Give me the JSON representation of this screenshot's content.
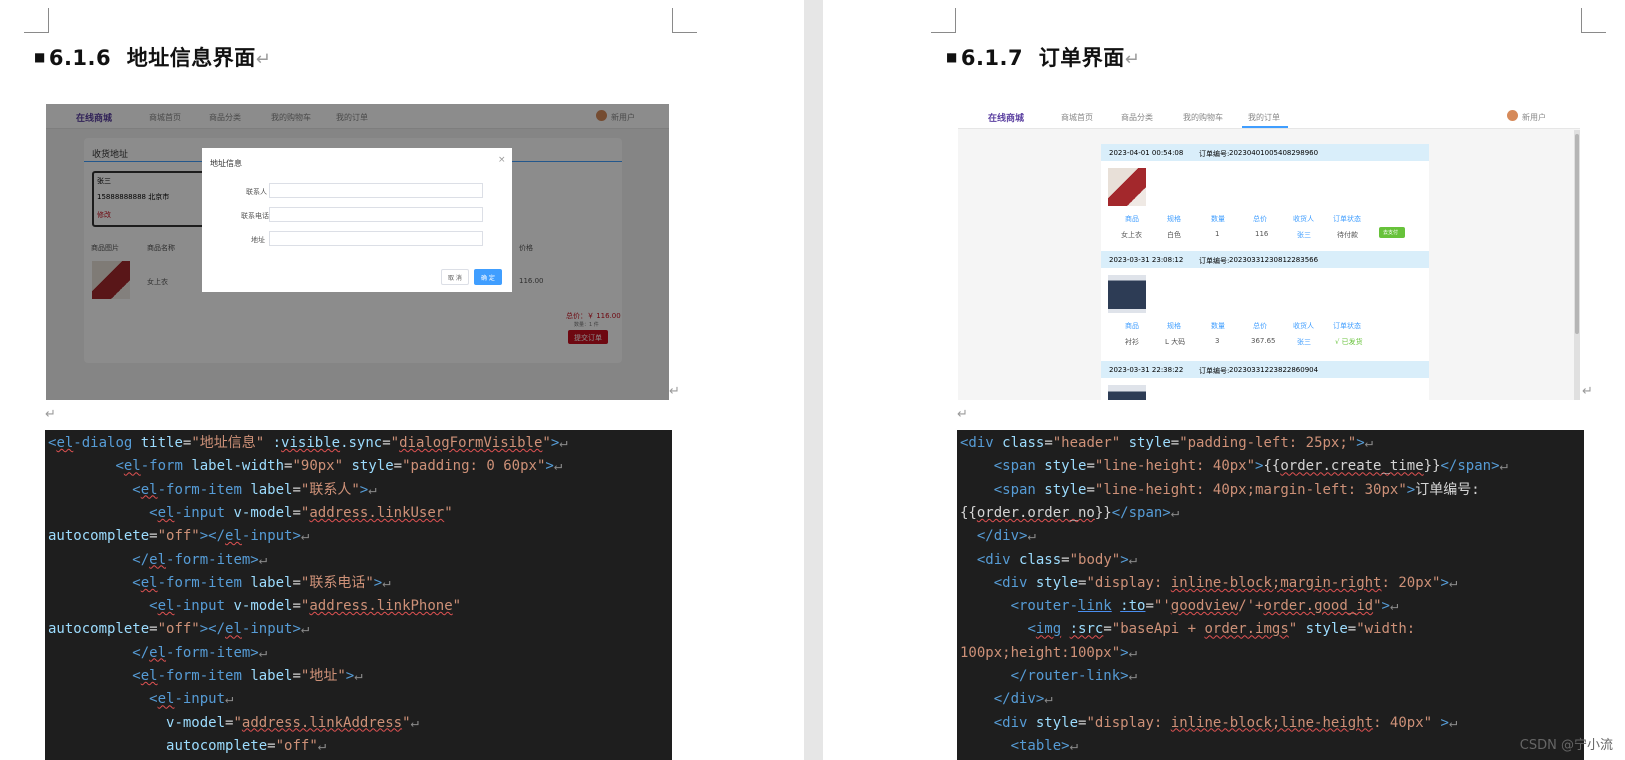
{
  "left": {
    "heading_number": "6.1.6",
    "heading_title": "地址信息界面",
    "screenshot": {
      "nav": {
        "brand": "在线商城",
        "items": [
          "商城首页",
          "商品分类",
          "我的购物车",
          "我的订单"
        ],
        "user": "新用户"
      },
      "address_card_title": "收货地址",
      "address_name": "张三",
      "address_detail": "15888888888 北京市",
      "address_edit": "修改",
      "col_headers": [
        "商品图片",
        "商品名称",
        "价格"
      ],
      "product_name": "女上衣",
      "product_price": "116.00",
      "total": "总价：￥ 116.00",
      "total_sub": "数量：1 件",
      "submit_label": "提交订单",
      "dialog": {
        "title": "地址信息",
        "close": "×",
        "field_labels": [
          "联系人",
          "联系电话",
          "地址"
        ],
        "cancel": "取 消",
        "confirm": "确 定"
      }
    },
    "code_lines": [
      [
        [
          "tg",
          "<"
        ],
        [
          "tg sq",
          "el"
        ],
        [
          "tg",
          "-dialog "
        ],
        [
          "at",
          "title"
        ],
        [
          "tx",
          "="
        ],
        [
          "st",
          "\"地址信息\""
        ],
        [
          "at",
          " :"
        ],
        [
          "at sq",
          "visible"
        ],
        [
          "at",
          ".sync"
        ],
        [
          "tx",
          "="
        ],
        [
          "st",
          "\""
        ],
        [
          "st sq",
          "dialogFormVisible"
        ],
        [
          "st",
          "\""
        ],
        [
          "tg",
          ">"
        ],
        [
          "pm",
          "↵"
        ]
      ],
      [
        [
          "tx",
          "        "
        ],
        [
          "tg",
          "<"
        ],
        [
          "tg sq",
          "el"
        ],
        [
          "tg",
          "-form "
        ],
        [
          "at",
          "label-width"
        ],
        [
          "tx",
          "="
        ],
        [
          "st",
          "\"90px\" "
        ],
        [
          "at",
          "style"
        ],
        [
          "tx",
          "="
        ],
        [
          "st",
          "\"padding: 0 60px\""
        ],
        [
          "tg",
          ">"
        ],
        [
          "pm",
          "↵"
        ]
      ],
      [
        [
          "tx",
          "          "
        ],
        [
          "tg",
          "<"
        ],
        [
          "tg sq",
          "el"
        ],
        [
          "tg",
          "-form-item "
        ],
        [
          "at",
          "label"
        ],
        [
          "tx",
          "="
        ],
        [
          "st",
          "\"联系人\""
        ],
        [
          "tg",
          ">"
        ],
        [
          "pm",
          "↵"
        ]
      ],
      [
        [
          "tx",
          "            "
        ],
        [
          "tg",
          "<"
        ],
        [
          "tg sq",
          "el"
        ],
        [
          "tg",
          "-input "
        ],
        [
          "at",
          "v-model"
        ],
        [
          "tx",
          "="
        ],
        [
          "st",
          "\""
        ],
        [
          "st sq",
          "address.linkUser"
        ],
        [
          "st",
          "\""
        ]
      ],
      [
        [
          "at",
          "autocomplete"
        ],
        [
          "tx",
          "="
        ],
        [
          "st",
          "\"off\""
        ],
        [
          "tg",
          "></"
        ],
        [
          "tg sq",
          "el"
        ],
        [
          "tg",
          "-input>"
        ],
        [
          "pm",
          "↵"
        ]
      ],
      [
        [
          "tx",
          "          "
        ],
        [
          "tg",
          "</"
        ],
        [
          "tg sq",
          "el"
        ],
        [
          "tg",
          "-form-item>"
        ],
        [
          "pm",
          "↵"
        ]
      ],
      [
        [
          "tx",
          "          "
        ],
        [
          "tg",
          "<"
        ],
        [
          "tg sq",
          "el"
        ],
        [
          "tg",
          "-form-item "
        ],
        [
          "at",
          "label"
        ],
        [
          "tx",
          "="
        ],
        [
          "st",
          "\"联系电话\""
        ],
        [
          "tg",
          ">"
        ],
        [
          "pm",
          "↵"
        ]
      ],
      [
        [
          "tx",
          "            "
        ],
        [
          "tg",
          "<"
        ],
        [
          "tg sq",
          "el"
        ],
        [
          "tg",
          "-input "
        ],
        [
          "at",
          "v-model"
        ],
        [
          "tx",
          "="
        ],
        [
          "st",
          "\""
        ],
        [
          "st sq",
          "address.linkPhone"
        ],
        [
          "st",
          "\""
        ]
      ],
      [
        [
          "at",
          "autocomplete"
        ],
        [
          "tx",
          "="
        ],
        [
          "st",
          "\"off\""
        ],
        [
          "tg",
          "></"
        ],
        [
          "tg sq",
          "el"
        ],
        [
          "tg",
          "-input>"
        ],
        [
          "pm",
          "↵"
        ]
      ],
      [
        [
          "tx",
          "          "
        ],
        [
          "tg",
          "</"
        ],
        [
          "tg sq",
          "el"
        ],
        [
          "tg",
          "-form-item>"
        ],
        [
          "pm",
          "↵"
        ]
      ],
      [
        [
          "tx",
          "          "
        ],
        [
          "tg",
          "<"
        ],
        [
          "tg sq",
          "el"
        ],
        [
          "tg",
          "-form-item "
        ],
        [
          "at",
          "label"
        ],
        [
          "tx",
          "="
        ],
        [
          "st",
          "\"地址\""
        ],
        [
          "tg",
          ">"
        ],
        [
          "pm",
          "↵"
        ]
      ],
      [
        [
          "tx",
          "            "
        ],
        [
          "tg",
          "<"
        ],
        [
          "tg sq",
          "el"
        ],
        [
          "tg",
          "-input"
        ],
        [
          "pm",
          "↵"
        ]
      ],
      [
        [
          "tx",
          "              "
        ],
        [
          "at",
          "v-model"
        ],
        [
          "tx",
          "="
        ],
        [
          "st",
          "\""
        ],
        [
          "st sq",
          "address.linkAddress"
        ],
        [
          "st",
          "\""
        ],
        [
          "pm",
          "↵"
        ]
      ],
      [
        [
          "tx",
          "              "
        ],
        [
          "at",
          "autocomplete"
        ],
        [
          "tx",
          "="
        ],
        [
          "st",
          "\"off\""
        ],
        [
          "pm",
          "↵"
        ]
      ]
    ]
  },
  "right": {
    "heading_number": "6.1.7",
    "heading_title": "订单界面",
    "screenshot": {
      "nav": {
        "brand": "在线商城",
        "items": [
          "商城首页",
          "商品分类",
          "我的购物车",
          "我的订单"
        ],
        "user": "新用户"
      },
      "orders": [
        {
          "time": "2023-04-01 00:54:08",
          "no_label": "订单编号:",
          "no": "20230401005408298960",
          "cols": [
            "商品",
            "规格",
            "数量",
            "总价",
            "收货人",
            "订单状态"
          ],
          "vals": [
            "女上衣",
            "白色",
            "1",
            "116",
            "张三",
            "待付款"
          ],
          "action": "去支付"
        },
        {
          "time": "2023-03-31 23:08:12",
          "no_label": "订单编号:",
          "no": "20230331230812283566",
          "cols": [
            "商品",
            "规格",
            "数量",
            "总价",
            "收货人",
            "订单状态"
          ],
          "vals": [
            "衬衫",
            "L 大码",
            "3",
            "367.65",
            "张三",
            "√ 已发货"
          ],
          "action": ""
        },
        {
          "time": "2023-03-31 22:38:22",
          "no_label": "订单编号:",
          "no": "20230331223822860904"
        }
      ]
    },
    "code_lines": [
      [
        [
          "tg",
          "<div "
        ],
        [
          "at",
          "class"
        ],
        [
          "tx",
          "="
        ],
        [
          "st",
          "\"header\" "
        ],
        [
          "at",
          "style"
        ],
        [
          "tx",
          "="
        ],
        [
          "st",
          "\"padding-left: 25px;\""
        ],
        [
          "tg",
          ">"
        ],
        [
          "pm",
          "↵"
        ]
      ],
      [
        [
          "tx",
          "    "
        ],
        [
          "tg",
          "<span "
        ],
        [
          "at",
          "style"
        ],
        [
          "tx",
          "="
        ],
        [
          "st",
          "\"line-height: 40px\""
        ],
        [
          "tg",
          ">"
        ],
        [
          "tx",
          "{{"
        ],
        [
          "tx sq",
          "order.create_time"
        ],
        [
          "tx",
          "}}"
        ],
        [
          "tg",
          "</span>"
        ],
        [
          "pm",
          "↵"
        ]
      ],
      [
        [
          "tx",
          "    "
        ],
        [
          "tg",
          "<span "
        ],
        [
          "at",
          "style"
        ],
        [
          "tx",
          "="
        ],
        [
          "st",
          "\"line-height: 40px;margin-left: 30px\""
        ],
        [
          "tg",
          ">"
        ],
        [
          "tx",
          "订单编号:"
        ]
      ],
      [
        [
          "tx",
          "{{"
        ],
        [
          "tx sq",
          "order.order_no"
        ],
        [
          "tx",
          "}}"
        ],
        [
          "tg",
          "</span>"
        ],
        [
          "pm",
          "↵"
        ]
      ],
      [
        [
          "tx",
          "  "
        ],
        [
          "tg",
          "</div>"
        ],
        [
          "pm",
          "↵"
        ]
      ],
      [
        [
          "tx",
          "  "
        ],
        [
          "tg",
          "<div "
        ],
        [
          "at",
          "class"
        ],
        [
          "tx",
          "="
        ],
        [
          "st",
          "\"body\""
        ],
        [
          "tg",
          ">"
        ],
        [
          "pm",
          "↵"
        ]
      ],
      [
        [
          "tx",
          "    "
        ],
        [
          "tg",
          "<div "
        ],
        [
          "at",
          "style"
        ],
        [
          "tx",
          "="
        ],
        [
          "st",
          "\"display: "
        ],
        [
          "st sq",
          "inline-block;margin-right"
        ],
        [
          "st",
          ": 20px\""
        ],
        [
          "tg",
          ">"
        ],
        [
          "pm",
          "↵"
        ]
      ],
      [
        [
          "tx",
          "      "
        ],
        [
          "tg",
          "<router-"
        ],
        [
          "tg lk",
          "link"
        ],
        [
          "tx",
          " "
        ],
        [
          "at lk",
          ":to"
        ],
        [
          "tx",
          "="
        ],
        [
          "st",
          "\"'"
        ],
        [
          "st sq",
          "goodview"
        ],
        [
          "st",
          "/'+"
        ],
        [
          "st sq",
          "order.good_id"
        ],
        [
          "st",
          "\""
        ],
        [
          "tg",
          ">"
        ],
        [
          "pm",
          "↵"
        ]
      ],
      [
        [
          "tx",
          "        "
        ],
        [
          "tg",
          "<"
        ],
        [
          "tg sq",
          "img"
        ],
        [
          "tx",
          " "
        ],
        [
          "at sq",
          ":src"
        ],
        [
          "tx",
          "="
        ],
        [
          "st",
          "\"baseApi + "
        ],
        [
          "st sq",
          "order.imgs"
        ],
        [
          "st",
          "\" "
        ],
        [
          "at",
          "style"
        ],
        [
          "tx",
          "="
        ],
        [
          "st",
          "\"width:"
        ]
      ],
      [
        [
          "st",
          "100px;height:100px\""
        ],
        [
          "tg",
          ">"
        ],
        [
          "pm",
          "↵"
        ]
      ],
      [
        [
          "tx",
          "      "
        ],
        [
          "tg",
          "</router-link>"
        ],
        [
          "pm",
          "↵"
        ]
      ],
      [
        [
          "tx",
          "    "
        ],
        [
          "tg",
          "</div>"
        ],
        [
          "pm",
          "↵"
        ]
      ],
      [
        [
          "tx",
          "    "
        ],
        [
          "tg",
          "<div "
        ],
        [
          "at",
          "style"
        ],
        [
          "tx",
          "="
        ],
        [
          "st",
          "\"display: "
        ],
        [
          "st sq",
          "inline-block;line-height"
        ],
        [
          "st",
          ": 40px\" "
        ],
        [
          "tg",
          ">"
        ],
        [
          "pm",
          "↵"
        ]
      ],
      [
        [
          "tx",
          "      "
        ],
        [
          "tg",
          "<table>"
        ],
        [
          "pm",
          "↵"
        ]
      ]
    ]
  },
  "para_mark": "↵",
  "watermark": "CSDN @宁小流",
  "colors": {
    "code_bg": "#1e1e1e",
    "tag": "#569cd6",
    "attr": "#9cdcfe",
    "string": "#ce9178",
    "brand": "#5a3fa0",
    "primary_btn": "#409eff",
    "danger_btn": "#c8101f",
    "order_header": "#d9eefa"
  }
}
